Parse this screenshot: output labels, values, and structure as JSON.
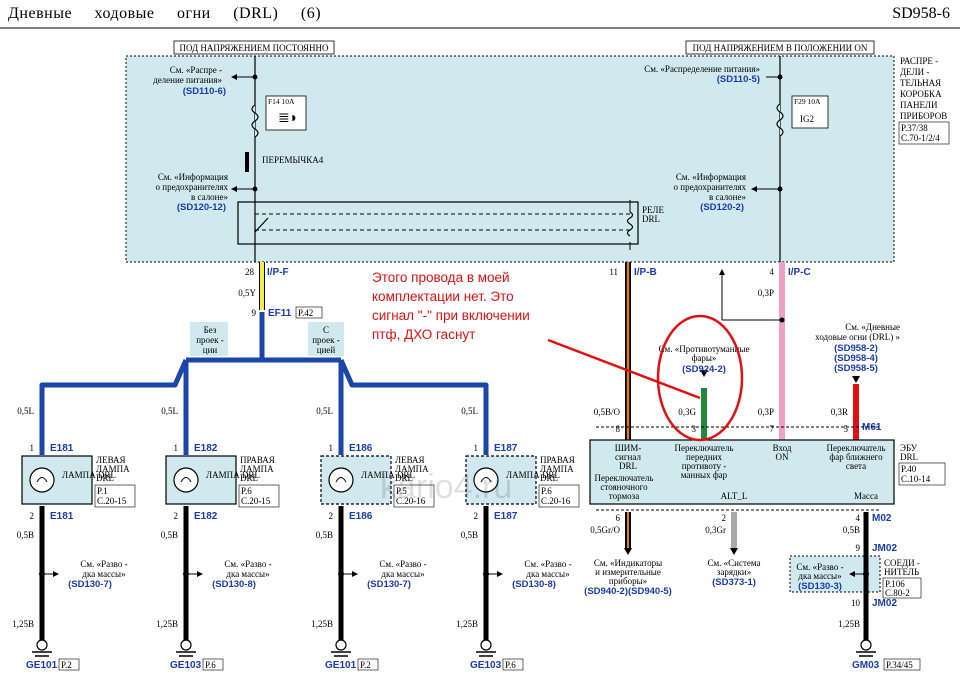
{
  "header": {
    "title": "Дневные ходовые огни (DRL) (6)",
    "code": "SD958-6"
  },
  "power": {
    "constant": "ПОД НАПРЯЖЕНИЕМ ПОСТОЯННО",
    "on": "ПОД НАПРЯЖЕНИЕМ В ПОЛОЖЕНИИ ON"
  },
  "junction_box": {
    "name": [
      "РАСПРЕ -",
      "ДЕЛИ -",
      "ТЕЛЬНАЯ",
      "КОРОБКА",
      "ПАНЕЛИ",
      "ПРИБОРОВ"
    ],
    "page": [
      "P.37/38",
      "C.70-1/2/4"
    ]
  },
  "refs": {
    "dist_left": [
      "См. «Распре -",
      "деление   питания»"
    ],
    "dist_left_code": "(SD110-6)",
    "dist_right": "См. «Распределение  питания»",
    "dist_right_code": "(SD110-5)",
    "fuse_info_left": [
      "См. «Информация",
      "о предохранителях",
      "в салоне»"
    ],
    "fuse_info_left_code": "(SD120-12)",
    "fuse_info_right": [
      "См. «Информация",
      "о предохранителях",
      "в салоне»"
    ],
    "fuse_info_right_code": "(SD120-2)",
    "fog": [
      "См. «Противотуманные",
      "фары»"
    ],
    "fog_code": "(SD924-2)",
    "drl": [
      "См. «Дневные",
      "ходовые огни (DRL) »"
    ],
    "drl_codes": [
      "(SD958-2)",
      "(SD958-4)",
      "(SD958-5)"
    ],
    "ground_text": [
      "См. «Разво -",
      "дка массы»"
    ],
    "ground_codes": [
      "(SD130-7)",
      "(SD130-8)",
      "(SD130-7)",
      "(SD130-8)"
    ],
    "cluster": [
      "См. «Индикаторы",
      "и измерительные",
      "приборы»"
    ],
    "cluster_codes": "(SD940-2)(SD940-5)",
    "charging": [
      "См. «Система",
      "зарядки»"
    ],
    "charging_code": "(SD373-1)",
    "ground_right_code": "(SD130-3)"
  },
  "fuses": {
    "f14": "F14 10A",
    "f29": "F29 10A",
    "ig2": "IG2"
  },
  "jumper": "ПЕРЕМЫЧКА4",
  "relay": [
    "РЕЛЕ",
    "DRL"
  ],
  "connectors": {
    "ipf": "I/P-F",
    "ipb": "I/P-B",
    "ipc": "I/P-C",
    "ef11": "EF11",
    "ef11_page": "P.42",
    "m61": "M61",
    "m02": "M02",
    "jm02a": "JM02",
    "jm02b": "JM02"
  },
  "pins": {
    "ipf": "28",
    "ipb": "11",
    "ipc": "4",
    "ef11": "9"
  },
  "wires": {
    "w05y": "0,5Y",
    "w05bo": "0,5B/O",
    "w03p_top": "0,3P",
    "w03p": "0,3P",
    "w03g": "0,3G",
    "w03r": "0,3R",
    "w05gro": "0,5Gr/O",
    "w03gr": "0,3Gr",
    "w05b_right": "0,5B",
    "w125b_right": "1,25B"
  },
  "splits": {
    "no_proj": [
      "Без",
      "проек -",
      "ции"
    ],
    "with_proj": [
      "С",
      "проек -",
      "цией"
    ]
  },
  "lamps": [
    {
      "conn": "E181",
      "name": [
        "ЛЕВАЯ",
        "ЛАМПА",
        "DRL"
      ],
      "page": [
        "P.1",
        "C.20-15"
      ],
      "ground": "GE101",
      "gpage": "P.2"
    },
    {
      "conn": "E182",
      "name": [
        "ПРАВАЯ",
        "ЛАМПА",
        "DRL"
      ],
      "page": [
        "P.6",
        "C.20-15"
      ],
      "ground": "GE103",
      "gpage": "P.6"
    },
    {
      "conn": "E186",
      "name": [
        "ЛЕВАЯ",
        "ЛАМПА",
        "DRL"
      ],
      "page": [
        "P.5",
        "C.20-16"
      ],
      "ground": "GE101",
      "gpage": "P.2"
    },
    {
      "conn": "E187",
      "name": [
        "ПРАВАЯ",
        "ЛАМПА",
        "DRL"
      ],
      "page": [
        "P.6",
        "C.20-16"
      ],
      "ground": "GE103",
      "gpage": "P.6"
    }
  ],
  "lamp_label": "ЛАМПА DRL",
  "lamp_wire_top": "0,5L",
  "lamp_wire_mid": "0,5B",
  "lamp_wire_bot": "1,25B",
  "ecu": {
    "name": [
      "ЭБУ",
      "DRL"
    ],
    "page": [
      "P.40",
      "C.10-14"
    ],
    "pwm": [
      "ШИМ-",
      "сигнал",
      "DRL"
    ],
    "fog_sw": [
      "Переключатель",
      "передних",
      "противоту -",
      "манных  фар"
    ],
    "on_in": [
      "Вход",
      "ON"
    ],
    "low_sw": [
      "Переключатель",
      "фар ближнего",
      "света"
    ],
    "park_sw": [
      "Переключатель",
      "стояночного",
      "тормоза"
    ],
    "alt": "ALT_L",
    "ground": "Масса",
    "pins_top": [
      "8",
      "3",
      "7",
      "5"
    ],
    "pins_bot": [
      "6",
      "2",
      "4"
    ]
  },
  "splice": {
    "name": [
      "СОЕДИ -",
      "НИТЕЛЬ"
    ],
    "page": [
      "P.106",
      "C.80-2"
    ],
    "pin_in": "9",
    "pin_out": "10"
  },
  "gm03": {
    "name": "GM03",
    "page": "P.34/45"
  },
  "annotation": [
    "Этого провода в моей",
    "комплектации нет. Это",
    "сигнал \"-\" при включении",
    "птф, ДХО гаснут"
  ],
  "watermark": "kario4.ru",
  "colors": {
    "box_fill": "#cfe9ee",
    "blue": "#1946a8",
    "orange": "#e07a1a",
    "pink": "#f0a0c8",
    "green": "#1f8a3a",
    "red": "#e01010",
    "yellow": "#f0f040",
    "grey": "#aaaaaa"
  }
}
